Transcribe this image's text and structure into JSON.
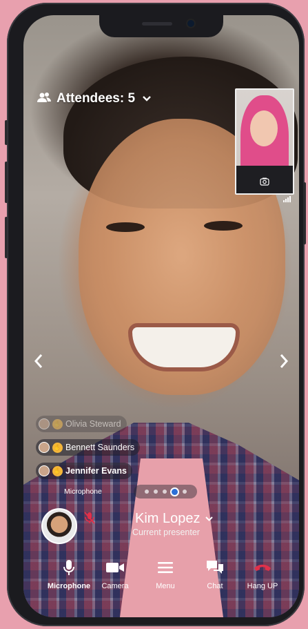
{
  "attendees": {
    "label": "Attendees: 5",
    "icon": "people-icon"
  },
  "reactions": [
    {
      "name": "Olivia Steward",
      "faded": true
    },
    {
      "name": "Bennett Saunders",
      "faded": false
    },
    {
      "name": "Jennifer Evans",
      "faded": false,
      "bold": true
    }
  ],
  "active_speaker_label": "Microphone",
  "pagination": {
    "pages": 5,
    "active": 4
  },
  "presenter": {
    "name": "Kim Lopez",
    "role": "Current presenter",
    "mic_muted": true
  },
  "controls": {
    "microphone": "Microphone",
    "camera": "Camera",
    "menu": "Menu",
    "chat": "Chat",
    "hangup": "Hang UP"
  },
  "colors": {
    "hangup": "#e0304a",
    "accent": "#2d6fd6",
    "background": "#e8a0ae"
  }
}
